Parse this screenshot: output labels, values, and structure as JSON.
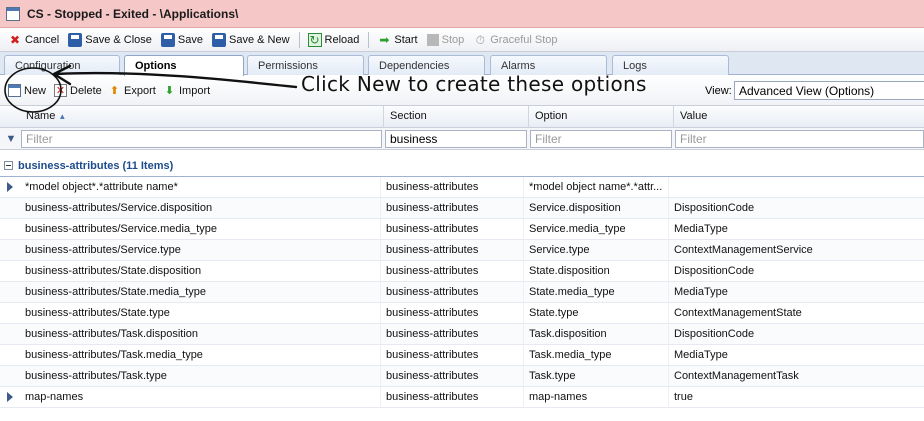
{
  "window": {
    "title": "CS - Stopped - Exited - \\Applications\\"
  },
  "toolbar": {
    "cancel": "Cancel",
    "save_close": "Save & Close",
    "save": "Save",
    "save_new": "Save & New",
    "reload": "Reload",
    "start": "Start",
    "stop": "Stop",
    "graceful_stop": "Graceful Stop"
  },
  "tabs": [
    "Configuration",
    "Options",
    "Permissions",
    "Dependencies",
    "Alarms",
    "Logs"
  ],
  "options_toolbar": {
    "new": "New",
    "delete": "Delete",
    "export": "Export",
    "import": "Import",
    "view_label": "View:",
    "view_value": "Advanced View (Options)"
  },
  "annotation": "Click New to create these options",
  "grid": {
    "columns": [
      "Name",
      "Section",
      "Option",
      "Value"
    ],
    "filter": {
      "placeholder": "Filter",
      "section_value": "business"
    },
    "group": {
      "title": "business-attributes (11 Items)"
    },
    "rows": [
      {
        "name": "*model object*.*attribute name*",
        "section": "business-attributes",
        "option": "*model object name*.*attr...",
        "value": ""
      },
      {
        "name": "business-attributes/Service.disposition",
        "section": "business-attributes",
        "option": "Service.disposition",
        "value": "DispositionCode"
      },
      {
        "name": "business-attributes/Service.media_type",
        "section": "business-attributes",
        "option": "Service.media_type",
        "value": "MediaType"
      },
      {
        "name": "business-attributes/Service.type",
        "section": "business-attributes",
        "option": "Service.type",
        "value": "ContextManagementService"
      },
      {
        "name": "business-attributes/State.disposition",
        "section": "business-attributes",
        "option": "State.disposition",
        "value": "DispositionCode"
      },
      {
        "name": "business-attributes/State.media_type",
        "section": "business-attributes",
        "option": "State.media_type",
        "value": "MediaType"
      },
      {
        "name": "business-attributes/State.type",
        "section": "business-attributes",
        "option": "State.type",
        "value": "ContextManagementState"
      },
      {
        "name": "business-attributes/Task.disposition",
        "section": "business-attributes",
        "option": "Task.disposition",
        "value": "DispositionCode"
      },
      {
        "name": "business-attributes/Task.media_type",
        "section": "business-attributes",
        "option": "Task.media_type",
        "value": "MediaType"
      },
      {
        "name": "business-attributes/Task.type",
        "section": "business-attributes",
        "option": "Task.type",
        "value": "ContextManagementTask"
      },
      {
        "name": "map-names",
        "section": "business-attributes",
        "option": "map-names",
        "value": "true"
      }
    ]
  }
}
